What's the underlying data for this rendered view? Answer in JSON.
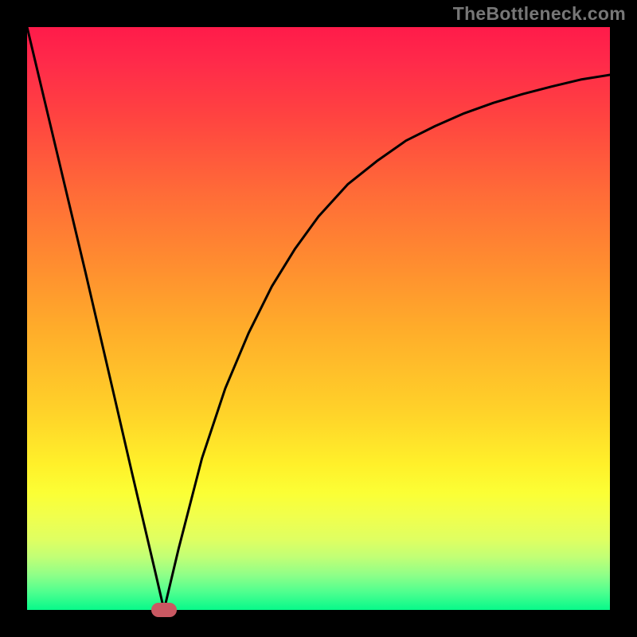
{
  "watermark": "TheBottleneck.com",
  "chart_data": {
    "type": "line",
    "title": "",
    "xlabel": "",
    "ylabel": "",
    "xlim": [
      0,
      1
    ],
    "ylim": [
      0,
      1
    ],
    "series": [
      {
        "name": "curve",
        "x": [
          0.0,
          0.05,
          0.1,
          0.15,
          0.18,
          0.2,
          0.22,
          0.235,
          0.26,
          0.3,
          0.34,
          0.38,
          0.42,
          0.46,
          0.5,
          0.55,
          0.6,
          0.65,
          0.7,
          0.75,
          0.8,
          0.85,
          0.9,
          0.95,
          1.0
        ],
        "y": [
          1.0,
          0.79,
          0.58,
          0.365,
          0.235,
          0.15,
          0.065,
          0.0,
          0.105,
          0.26,
          0.38,
          0.475,
          0.555,
          0.62,
          0.675,
          0.73,
          0.77,
          0.805,
          0.83,
          0.852,
          0.87,
          0.885,
          0.898,
          0.91,
          0.918
        ]
      }
    ],
    "marker": {
      "x": 0.235,
      "y": 0.0,
      "color": "#c95862"
    },
    "background_gradient": {
      "top": "#ff1b4a",
      "mid": "#ffd229",
      "bottom": "#07f98a"
    }
  }
}
